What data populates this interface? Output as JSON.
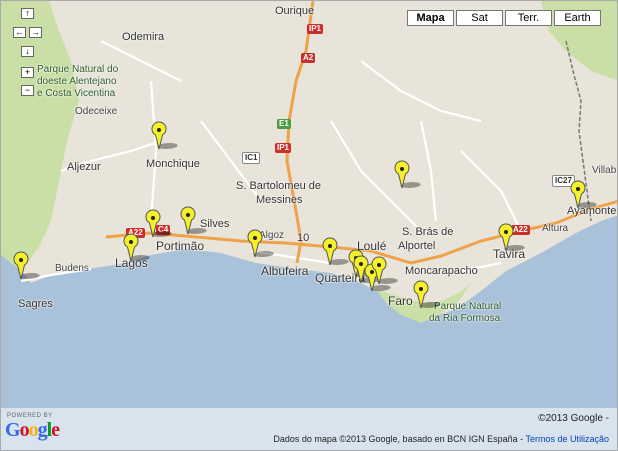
{
  "map_types": [
    {
      "label": "Mapa",
      "active": true
    },
    {
      "label": "Sat",
      "active": false
    },
    {
      "label": "Terr.",
      "active": false
    },
    {
      "label": "Earth",
      "active": false
    }
  ],
  "nav": {
    "up": "↑",
    "left": "←",
    "right": "→",
    "down": "↓",
    "zoom_in": "+",
    "zoom_out": "−"
  },
  "places": {
    "ourique": "Ourique",
    "odemira": "Odemira",
    "park_sw_1": "Parque Natural do",
    "park_sw_2": "doeste Alentejano",
    "park_sw_3": "e Costa Vicentina",
    "odeceixe": "Odeceixe",
    "aljezur": "Aljezur",
    "monchique": "Monchique",
    "sbartolomeu_1": "S. Bartolomeu de",
    "sbartolomeu_2": "Messines",
    "silves": "Silves",
    "portimao": "Portimão",
    "lagos": "Lagos",
    "budens": "Budens",
    "sagres": "Sagres",
    "albufeira": "Albufeira",
    "algoz": "Algoz",
    "loule": "Loulé",
    "quarteira": "Quarteira",
    "sbras_1": "S. Brás de",
    "sbras_2": "Alportel",
    "moncarapacho": "Moncarapacho",
    "faro": "Faro",
    "ria_formosa_1": "Parque Natural",
    "ria_formosa_2": "da Ria Formosa",
    "tavira": "Tavira",
    "altura": "Altura",
    "ayamonte": "Ayamonte",
    "villab": "Villab",
    "ten": "10"
  },
  "road_shields": {
    "ip1_north": "IP1",
    "a2": "A2",
    "e1": "E1",
    "ip1_south": "IP1",
    "ic1": "IC1",
    "a22_west": "A22",
    "c4": "C4",
    "a22_east": "A22",
    "ic27": "IC27"
  },
  "footer": {
    "powered_by": "POWERED BY",
    "logo": "Google",
    "copyright": "©2013 Google -",
    "map_data": "Dados do mapa ©2013 Google, basado en BCN IGN España -",
    "terms": "Termos de Utilização"
  },
  "colors": {
    "sea": "#a9c1d9",
    "land": "#e8e4da",
    "park": "#c9dfa5",
    "motorway": "#f0a24a",
    "marker": "#f6f02a"
  },
  "markers": [
    {
      "name": "Monchique"
    },
    {
      "name": "Sagres"
    },
    {
      "name": "Lagos"
    },
    {
      "name": "Portimão 1"
    },
    {
      "name": "Portimão 2"
    },
    {
      "name": "Albufeira"
    },
    {
      "name": "S. Bras area"
    },
    {
      "name": "Quarteira"
    },
    {
      "name": "Vilamoura 1"
    },
    {
      "name": "Vilamoura 2"
    },
    {
      "name": "Vilamoura 3"
    },
    {
      "name": "Vilamoura 4"
    },
    {
      "name": "Faro"
    },
    {
      "name": "Tavira"
    },
    {
      "name": "Ayamonte"
    }
  ]
}
